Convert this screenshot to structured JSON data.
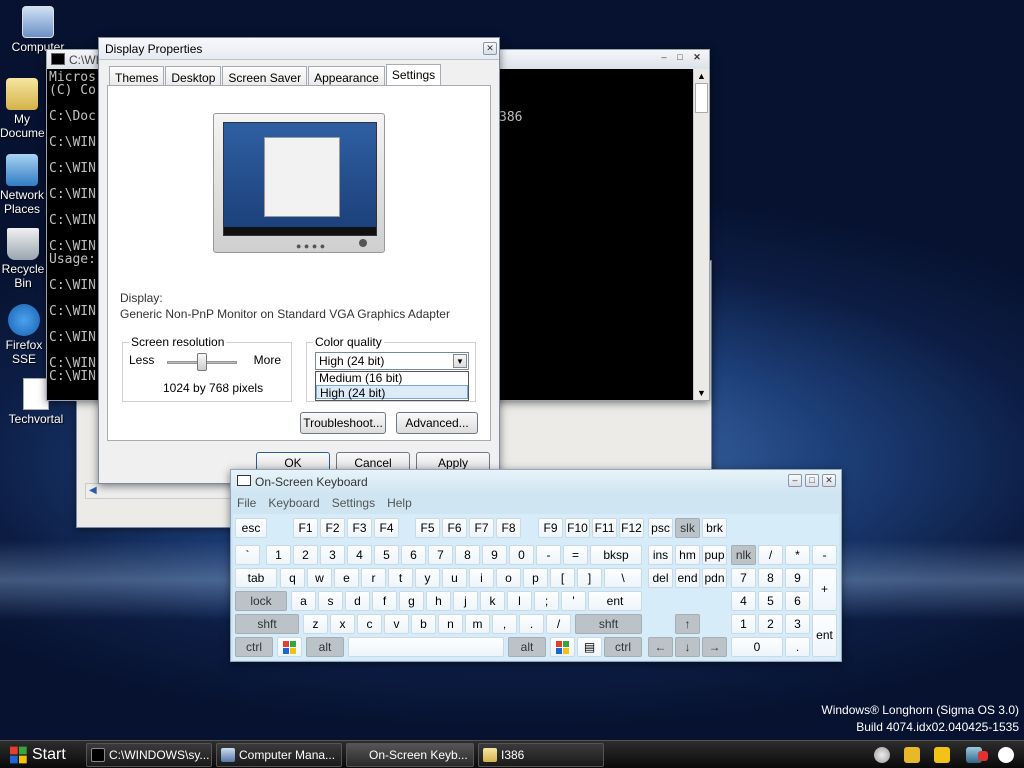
{
  "desktop": {
    "icons": [
      {
        "label": "Computer"
      },
      {
        "label": "My Documents"
      },
      {
        "label": "Network Places"
      },
      {
        "label": "Recycle Bin"
      },
      {
        "label": "Firefox SSE"
      },
      {
        "label": "Techvortal"
      }
    ],
    "watermark_line1": "Windows® Longhorn (Sigma OS 3.0)",
    "watermark_line2": "Build 4074.idx02.040425-1535"
  },
  "console": {
    "title": "C:\\WI",
    "lines": [
      "Micros",
      "(C) Co",
      "",
      "C:\\Doc",
      "",
      "C:\\WIN",
      "",
      "C:\\WIN",
      "",
      "C:\\WIN",
      "",
      "C:\\WIN",
      "",
      "C:\\WIN",
      "Usage:",
      "",
      "C:\\WIN",
      "",
      "C:\\WIN",
      "",
      "C:\\WIN",
      "",
      "C:\\WIN",
      "C:\\WIN"
    ],
    "right_text": "386"
  },
  "display_properties": {
    "title": "Display Properties",
    "tabs": [
      "Themes",
      "Desktop",
      "Screen Saver",
      "Appearance",
      "Settings"
    ],
    "active_tab": "Settings",
    "display_label": "Display:",
    "display_value": "Generic Non-PnP Monitor on Standard VGA Graphics Adapter",
    "resolution_group": "Screen resolution",
    "less_label": "Less",
    "more_label": "More",
    "resolution_value": "1024 by 768 pixels",
    "color_group": "Color quality",
    "color_selected": "High (24 bit)",
    "color_options": [
      "Medium (16 bit)",
      "High (24 bit)"
    ],
    "troubleshoot_label": "Troubleshoot...",
    "advanced_label": "Advanced...",
    "ok_label": "OK",
    "cancel_label": "Cancel",
    "apply_label": "Apply"
  },
  "osk": {
    "title": "On-Screen Keyboard",
    "menu": [
      "File",
      "Keyboard",
      "Settings",
      "Help"
    ],
    "rows": {
      "row1": [
        "esc",
        "F1",
        "F2",
        "F3",
        "F4",
        "F5",
        "F6",
        "F7",
        "F8",
        "F9",
        "F10",
        "F11",
        "F12",
        "psc",
        "slk",
        "brk"
      ],
      "row2": [
        "`",
        "1",
        "2",
        "3",
        "4",
        "5",
        "6",
        "7",
        "8",
        "9",
        "0",
        "-",
        "=",
        "bksp",
        "ins",
        "hm",
        "pup",
        "nlk",
        "/",
        "*",
        "-"
      ],
      "row3": [
        "tab",
        "q",
        "w",
        "e",
        "r",
        "t",
        "y",
        "u",
        "i",
        "o",
        "p",
        "[",
        "]",
        "\\",
        "del",
        "end",
        "pdn",
        "7",
        "8",
        "9",
        "+"
      ],
      "row4": [
        "lock",
        "a",
        "s",
        "d",
        "f",
        "g",
        "h",
        "j",
        "k",
        "l",
        ";",
        "'",
        "ent",
        "4",
        "5",
        "6"
      ],
      "row5": [
        "shft",
        "z",
        "x",
        "c",
        "v",
        "b",
        "n",
        "m",
        ",",
        ".",
        "/",
        "shft",
        "↑",
        "1",
        "2",
        "3",
        "ent"
      ],
      "row6": [
        "ctrl",
        "alt",
        "alt",
        "ctrl",
        "←",
        "↓",
        "→",
        "0",
        "."
      ]
    }
  },
  "taskbar": {
    "start_label": "Start",
    "tasks": [
      "C:\\WINDOWS\\sy...",
      "Computer Mana...",
      "On-Screen Keyb...",
      "I386"
    ]
  }
}
